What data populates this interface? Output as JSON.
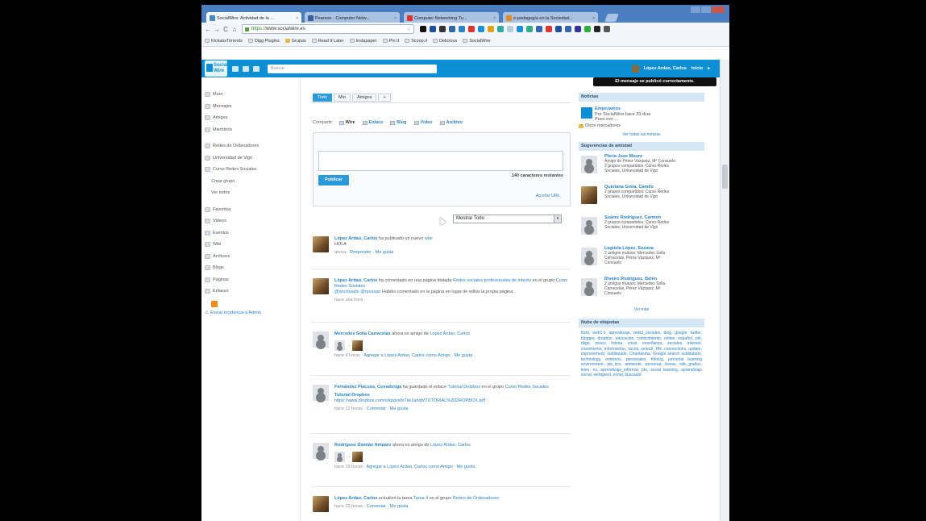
{
  "browser": {
    "tabs": [
      {
        "label": "SocialWire: Actividad de la ...",
        "color": "#4a86c6",
        "active": true
      },
      {
        "label": "Pearson - Computer Netw...",
        "color": "#3a5f9a",
        "active": false
      },
      {
        "label": "Computer Networking Tu...",
        "color": "#d33",
        "active": false
      },
      {
        "label": "e-pedagogía en la Sociedad...",
        "color": "#e08a2a",
        "active": false
      }
    ],
    "url_scheme": "https://",
    "url_host": "www.socialwire.es",
    "bookmarks": [
      {
        "label": "KickassTorrents",
        "icon": "page"
      },
      {
        "label": "Digg Plugins",
        "icon": "page"
      },
      {
        "label": "Grupos",
        "icon": "folder"
      },
      {
        "label": "Read It Later",
        "icon": "page"
      },
      {
        "label": "Instapaper",
        "icon": "page"
      },
      {
        "label": "Pin It",
        "icon": "page"
      },
      {
        "label": "Scoop.it",
        "icon": "page"
      },
      {
        "label": "Delicious",
        "icon": "page"
      },
      {
        "label": "SocialWire",
        "icon": "page"
      }
    ],
    "other_bookmarks": "Otros marcadores",
    "extension_colors": [
      "#111",
      "#1d4f9c",
      "#333",
      "#36a",
      "#2a82c8",
      "#d33",
      "#1d8fd6",
      "#e0a21b",
      "#3a9",
      "#bcd",
      "#1d8fd6",
      "#3a8",
      "#36a",
      "#d33",
      "#1d4f9c",
      "#36a",
      "#339",
      "#3a4",
      "#222",
      "#555"
    ]
  },
  "site": {
    "logo_line1": "Social",
    "logo_line2": "Wire",
    "search_placeholder": "Buscar",
    "user_name": "López Ardao, Carlos",
    "home_link": "Inicio",
    "flash_message": "El mensaje se publicó correctamente."
  },
  "left_nav": {
    "primary": [
      "Muro",
      "Mensajes",
      "Amigos",
      "Miembros"
    ],
    "groups": [
      "Redes de Ordenadores",
      "Universidad de Vigo",
      "Curso Redes Sociales"
    ],
    "group_actions": [
      "Crear grupo",
      "Ver todos"
    ],
    "secondary": [
      "Favoritos",
      "Videos",
      "Eventos",
      "Wiki",
      "Archivos",
      "Blogs",
      "Páginas",
      "Enlaces"
    ],
    "admin_link": "Enviar incidencia a Admin"
  },
  "center": {
    "tabs": [
      "Todo",
      "Mío",
      "Amigos",
      "+"
    ],
    "share_label": "Compartir:",
    "share_options": [
      "Wire",
      "Enlace",
      "Blog",
      "Vídeo",
      "Archivo"
    ],
    "publish_button": "Publicar",
    "char_count": "140 caracteres restantes",
    "shorten_url": "Acortar URL",
    "filter_value": "Mostrar Todo",
    "posts": [
      {
        "author": "López Ardao, Carlos",
        "action": " ha publicado un nuevo ",
        "link": "wire",
        "body": "HOLA",
        "meta_time": "ahora",
        "meta_links": [
          "Responder",
          "Me gusta"
        ],
        "avatar": "photo"
      },
      {
        "author": "López Ardao, Carlos",
        "action": " ha comentado en una página titulada ",
        "link": "Redes sociales profesionales de interés",
        "extra": " en el grupo ",
        "extra_link": "Curso Redes Sociales",
        "body_link": "@anchoadix",
        "body_link2": "@rpossan",
        "body": " Habéis comentado en la página en lugar de editar la propia página",
        "meta_time": "hace una hora",
        "avatar": "photo"
      },
      {
        "author": "Mercedes Solla Carracelas",
        "action": " ahora es amigo de ",
        "link": "López Ardao, Carlos",
        "meta_time": "hace 4 horas",
        "meta_links": [
          "Agregar a López Ardao, Carlos como Amigo",
          "Me gusta"
        ],
        "avatar": "silh",
        "friendpics": true
      },
      {
        "author": "Fernández Piacuos, Covadonga",
        "action": " ha guardado el enlace ",
        "link": "Tutorial Dropbox",
        "extra": " en el grupo ",
        "extra_link": "Curso Redes Sociales",
        "title": "Tutorial Dropbox",
        "url": "https://www.dropbox.com/s/kpgvx8r7ke1ahdb/TUTORIAL%20DROPBOX.pdf",
        "meta_time": "hace 12 horas",
        "meta_links": [
          "Comentar",
          "Me gusta"
        ],
        "avatar": "silh"
      },
      {
        "author": "Rodríguez Damián Amparo",
        "action": " ahora es amigo de ",
        "link": "López Ardao, Carlos",
        "meta_time": "hace 19 horas",
        "meta_links": [
          "Agregar a López Ardao, Carlos como Amigo",
          "Me gusta"
        ],
        "avatar": "silh",
        "friendpics": true
      },
      {
        "author": "López Ardao, Carlos",
        "action": " actualizó la tarea ",
        "link": "Tarea 4",
        "extra": " en el grupo ",
        "extra_link": "Redes de Ordenadores",
        "meta_time": "hace 23 horas",
        "meta_links": [
          "Comentar",
          "Me gusta"
        ],
        "avatar": "photo"
      }
    ]
  },
  "right": {
    "news_title": "Noticias",
    "news_item": {
      "title": "Empezamos",
      "byline": "Por SocialWire hace 29 días",
      "body": "Pues eso ..."
    },
    "news_all": "Ver todas las noticias",
    "suggest_title": "Sugerencias de amistad",
    "suggestions": [
      {
        "name": "Pleria Jose Moure",
        "lines": [
          "Amigo de Pérez Vázquez, Mª Consuelo",
          "2 grupos compartidos: Curso Redes",
          "Sociales, Universidad de Vigo"
        ],
        "avatar": "silh"
      },
      {
        "name": "Quintana Grela, Camilo",
        "lines": [
          "2 grupos compartidos: Curso Redes",
          "Sociales, Universidad de Vigo"
        ],
        "avatar": "face"
      },
      {
        "name": "Suárez Rodríguez, Carmen",
        "lines": [
          "2 grupos compartidos: Curso Redes",
          "Sociales, Universidad de Vigo"
        ],
        "avatar": "silh"
      },
      {
        "name": "Lagüela López, Susana",
        "lines": [
          "2 amigos mutuos: Mercedes Solla",
          "Carracelas, Pérez Vázquez, Mª",
          "Consuelo"
        ],
        "avatar": "silh"
      },
      {
        "name": "Riveiro Rodríguez, Belén",
        "lines": [
          "2 amigos mutuos: Mercedes Solla",
          "Carracelas, Pérez Vázquez, Mª",
          "Consuelo"
        ],
        "avatar": "silh"
      }
    ],
    "suggest_all": "Ver más",
    "tags_title": "Nube de etiquetas",
    "tags": "flickr, web2.0, aprendizaje, redes_sociales, blog, google, twitter, blogger, dropbox, educación, conocimiento, online, español, ple, diigo, mixeo, fotona, crisis, enseñanza, sociales, internet, crecimiento, información, social, search, HR, connections, update, improvement, subtitulado, Chantasma, Google search subtitulado, technology, entornos, personales, fotolog, personal learning environment, ple_tics, ambiente, personal, líneas, wiki_grados, lines, es, aprendizaje_informal, pln, social learning, aprendizaje social, webquest, zonal, buscador"
  }
}
